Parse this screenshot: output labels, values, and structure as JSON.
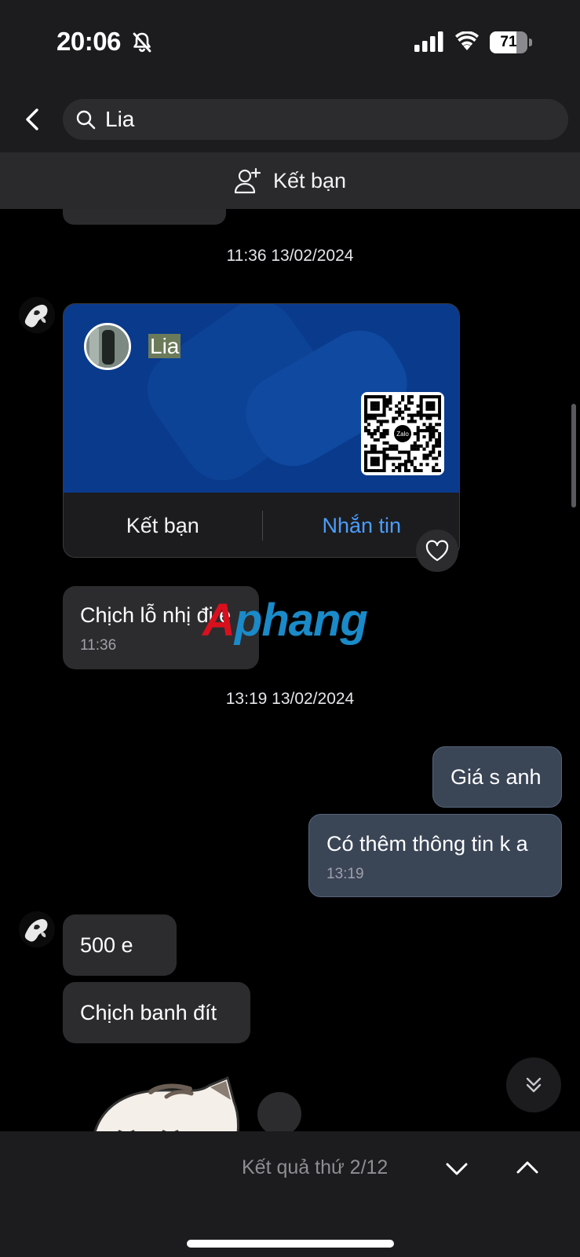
{
  "status_bar": {
    "time": "20:06",
    "battery": "71",
    "battery_level": 0.71
  },
  "search": {
    "query": "Lia"
  },
  "add_friend_bar": {
    "label": "Kết bạn"
  },
  "messages": {
    "timestamp_1": "11:36 13/02/2024",
    "contact_card": {
      "name": "Lia",
      "qr_brand": "Zalo",
      "add_friend_label": "Kết bạn",
      "message_label": "Nhắn tin"
    },
    "incoming_1": {
      "text": "Chịch lỗ nhị đi e",
      "time": "11:36"
    },
    "timestamp_2": "13:19 13/02/2024",
    "outgoing_1": {
      "text": "Giá s anh"
    },
    "outgoing_2": {
      "text": "Có thêm thông tin k a",
      "time": "13:19"
    },
    "incoming_2": {
      "text": "500 e"
    },
    "incoming_3": {
      "text": "Chịch banh đít"
    }
  },
  "watermark": {
    "text": "Aphang"
  },
  "search_results": {
    "label": "Kết quả thứ 2/12"
  },
  "colors": {
    "accent_blue": "#4a9dff",
    "card_blue": "#0a3a8c",
    "outgoing_bubble": "#3a4556"
  }
}
